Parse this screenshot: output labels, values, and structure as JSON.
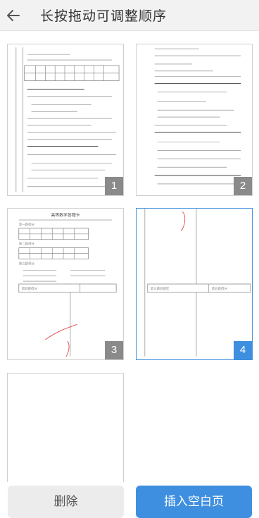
{
  "header": {
    "title": "长按拖动可调整顺序",
    "back_icon": "arrow-left-icon"
  },
  "pages": [
    {
      "number": "1"
    },
    {
      "number": "2"
    },
    {
      "number": "3",
      "doc_title": "高等数学答题卡",
      "sections": [
        "第一题得分",
        "第二题得分",
        "第三题得分",
        "第四题得分"
      ]
    },
    {
      "number": "4",
      "sections": [
        "第三题答题区",
        "第五题得分"
      ]
    },
    {
      "number": ""
    }
  ],
  "footer": {
    "delete_label": "删除",
    "insert_label": "插入空白页"
  },
  "colors": {
    "accent": "#3f8fe0",
    "badge": "#8a8a8a"
  }
}
